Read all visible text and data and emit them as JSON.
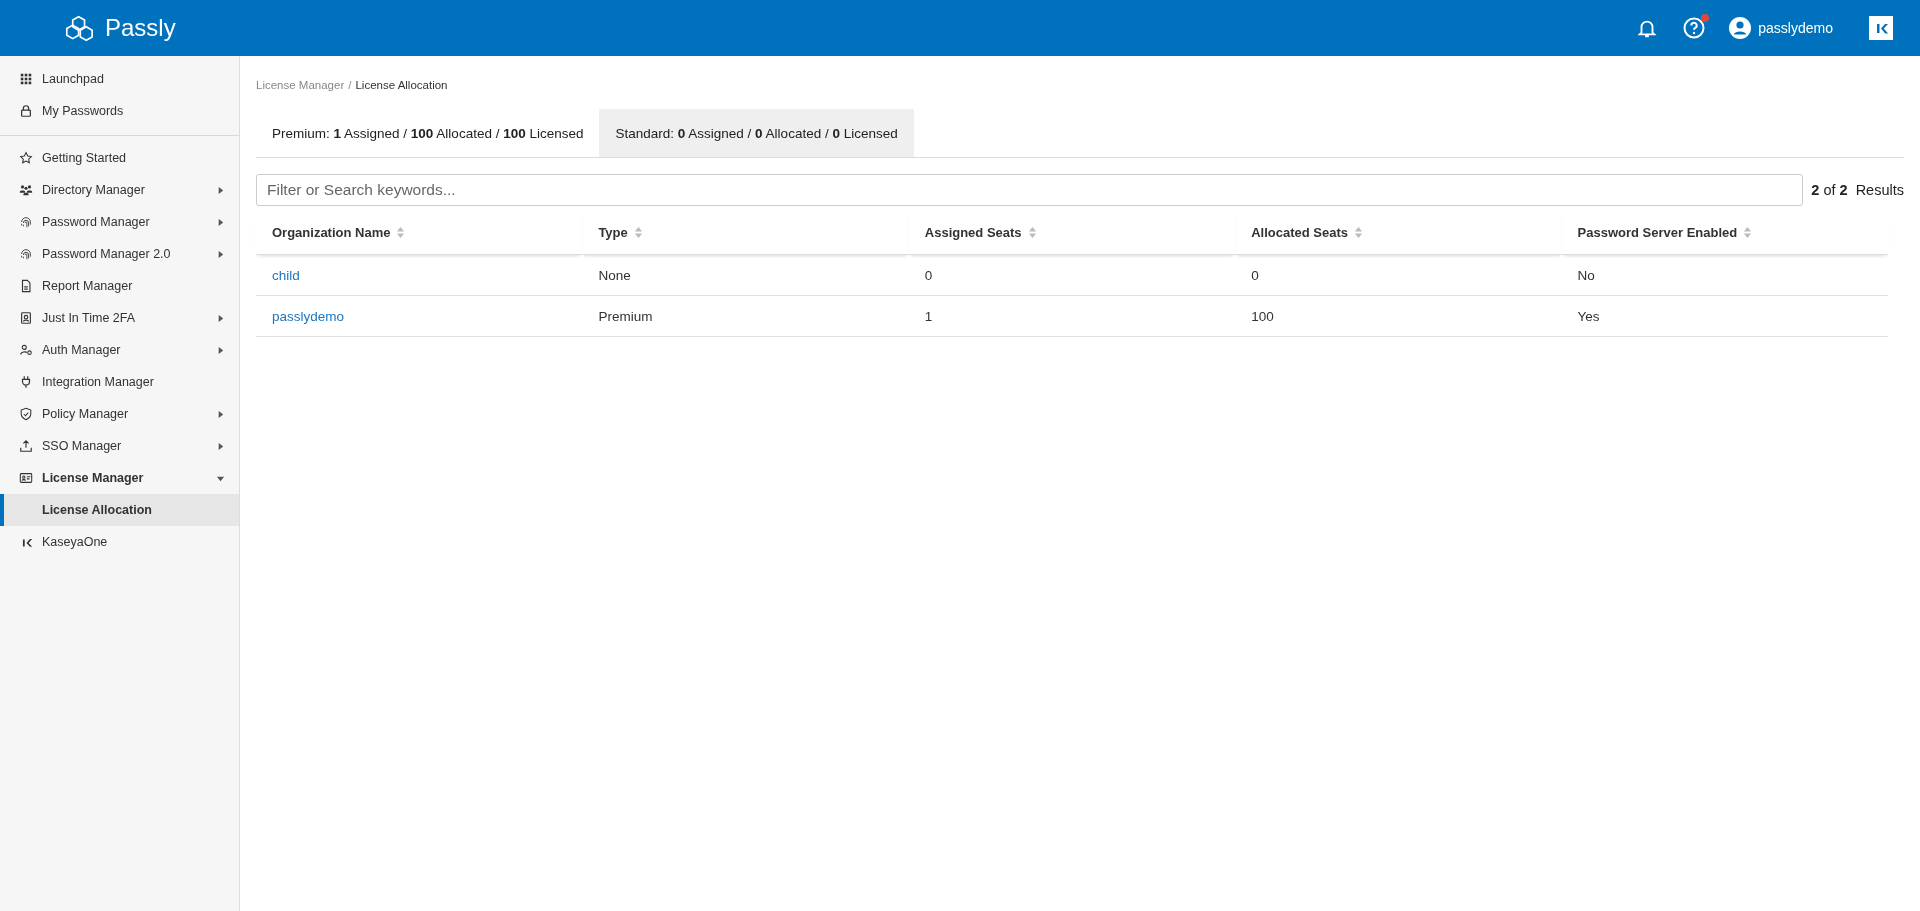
{
  "header": {
    "brand": "Passly",
    "user": "passlydemo",
    "help_badge": true
  },
  "sidebar": {
    "top": [
      {
        "label": "Launchpad",
        "selected": false
      },
      {
        "label": "My Passwords",
        "selected": false
      }
    ],
    "main": [
      {
        "label": "Getting Started",
        "selected": false,
        "expandable": false,
        "expanded": false
      },
      {
        "label": "Directory Manager",
        "selected": false,
        "expandable": true,
        "expanded": false
      },
      {
        "label": "Password Manager",
        "selected": false,
        "expandable": true,
        "expanded": false
      },
      {
        "label": "Password Manager 2.0",
        "selected": false,
        "expandable": true,
        "expanded": false
      },
      {
        "label": "Report Manager",
        "selected": false,
        "expandable": false,
        "expanded": false
      },
      {
        "label": "Just In Time 2FA",
        "selected": false,
        "expandable": true,
        "expanded": false
      },
      {
        "label": "Auth Manager",
        "selected": false,
        "expandable": true,
        "expanded": false
      },
      {
        "label": "Integration Manager",
        "selected": false,
        "expandable": false,
        "expanded": false
      },
      {
        "label": "Policy Manager",
        "selected": false,
        "expandable": true,
        "expanded": false
      },
      {
        "label": "SSO Manager",
        "selected": false,
        "expandable": true,
        "expanded": false
      },
      {
        "label": "License Manager",
        "selected": false,
        "expandable": true,
        "expanded": true,
        "children": [
          {
            "label": "License Allocation",
            "selected": true
          }
        ]
      },
      {
        "label": "KaseyaOne",
        "selected": false,
        "expandable": false,
        "expanded": false
      }
    ]
  },
  "breadcrumb": [
    "License Manager",
    "License Allocation"
  ],
  "breadcrumb_separator": "/",
  "tabs": [
    {
      "label": "Premium: **1** Assigned / **100** Allocated / **100** Licensed",
      "selected": true
    },
    {
      "label": "Standard: **0** Assigned / **0** Allocated / **0** Licensed",
      "selected": false
    }
  ],
  "search": {
    "placeholder": "Filter or Search keywords..."
  },
  "results": {
    "count": "**2** of **2**",
    "label": "Results"
  },
  "table": {
    "columns": [
      "Organization Name",
      "Type",
      "Assigned Seats",
      "Allocated Seats",
      "Password Server Enabled"
    ],
    "rows": [
      [
        "child",
        "None",
        "0",
        "0",
        "No"
      ],
      [
        "passlydemo",
        "Premium",
        "1",
        "100",
        "Yes"
      ]
    ]
  }
}
